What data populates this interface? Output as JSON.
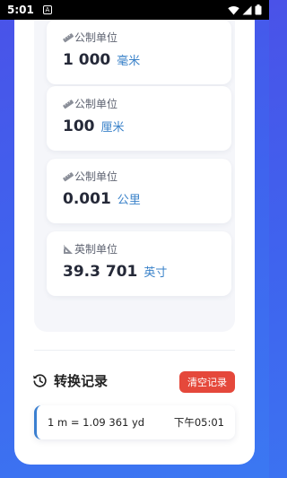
{
  "status_bar": {
    "time": "5:01",
    "notification_letter": "A",
    "icons": [
      "wifi-icon",
      "signal-icon",
      "battery-icon"
    ]
  },
  "results": [
    {
      "category": "公制单位",
      "category_icon": "ruler-icon",
      "value": "1 000",
      "unit": "毫米"
    },
    {
      "category": "公制单位",
      "category_icon": "ruler-icon",
      "value": "100",
      "unit": "厘米"
    },
    {
      "category": "公制单位",
      "category_icon": "ruler-icon",
      "value": "0.001",
      "unit": "公里"
    },
    {
      "category": "英制单位",
      "category_icon": "triangle-ruler-icon",
      "value": "39.3 701",
      "unit": "英寸"
    }
  ],
  "history": {
    "title": "转换记录",
    "title_icon": "history-icon",
    "clear_label": "清空记录",
    "records": [
      {
        "expression": "1 m = 1.09 361 yd",
        "time": "下午05:01"
      }
    ]
  },
  "colors": {
    "accent_blue": "#3a82c9",
    "clear_button": "#e5483b",
    "background_gradient_start": "#4a52e8",
    "background_gradient_end": "#3b78f2"
  }
}
